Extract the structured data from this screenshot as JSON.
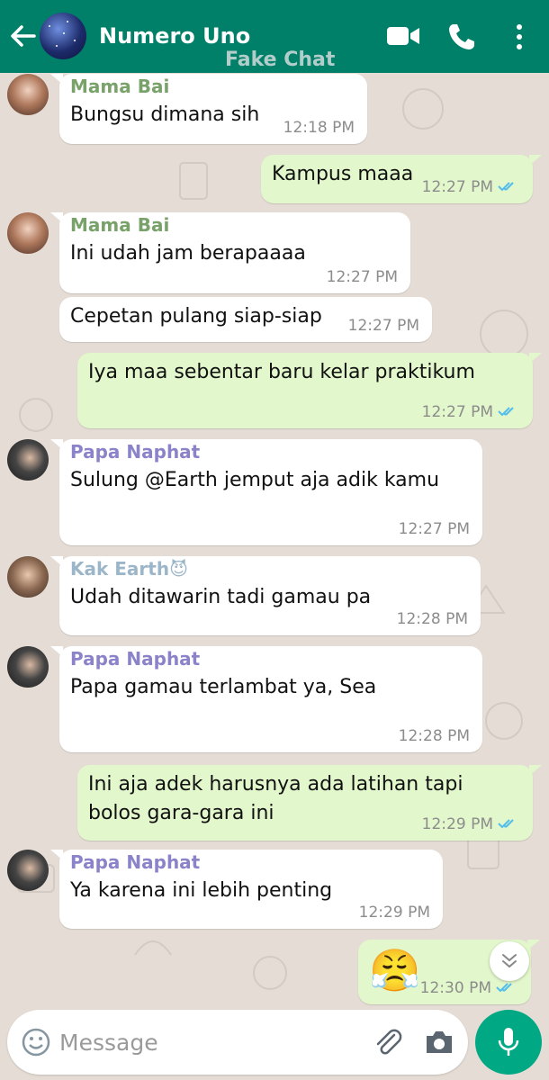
{
  "header": {
    "title": "Numero Uno",
    "watermark": "Fake Chat",
    "icons": [
      "back-arrow-icon",
      "video-call-icon",
      "phone-call-icon",
      "more-options-icon"
    ],
    "color": "#008069"
  },
  "messages": [
    {
      "direction": "in",
      "sender": "Mama Bai",
      "sender_color": "#78a26a",
      "lines": [
        "Bungsu dimana sih"
      ],
      "time": "12:18 PM"
    },
    {
      "direction": "out",
      "lines": [
        "Kampus maaa"
      ],
      "time": "12:27 PM",
      "read": true
    },
    {
      "direction": "in",
      "sender": "Mama Bai",
      "sender_color": "#78a26a",
      "lines": [
        "Ini udah jam berapaaaa"
      ],
      "time": "12:27 PM"
    },
    {
      "direction": "in",
      "lines": [
        "Cepetan pulang siap-siap"
      ],
      "time": "12:27 PM"
    },
    {
      "direction": "out",
      "lines": [
        "Iya maa sebentar baru kelar praktikum"
      ],
      "time": "12:27 PM",
      "read": true
    },
    {
      "direction": "in",
      "sender": "Papa Naphat",
      "sender_color": "#8b83c9",
      "lines": [
        "Sulung @Earth jemput aja adik kamu"
      ],
      "time": "12:27 PM"
    },
    {
      "direction": "in",
      "sender": "Kak Earth",
      "sender_emoji": "😈",
      "sender_color": "#9cb6c9",
      "lines": [
        "Udah ditawarin tadi gamau pa"
      ],
      "time": "12:28 PM"
    },
    {
      "direction": "in",
      "sender": "Papa Naphat",
      "sender_color": "#8b83c9",
      "lines": [
        "Papa gamau terlambat ya, Sea"
      ],
      "time": "12:28 PM"
    },
    {
      "direction": "out",
      "lines": [
        "Ini aja adek harusnya ada latihan tapi",
        "bolos gara-gara ini"
      ],
      "time": "12:29 PM",
      "read": true
    },
    {
      "direction": "in",
      "sender": "Papa Naphat",
      "sender_color": "#8b83c9",
      "lines": [
        "Ya karena ini lebih penting"
      ],
      "time": "12:29 PM"
    },
    {
      "direction": "out",
      "emoji": "😤",
      "time": "12:30 PM",
      "read": true
    }
  ],
  "input": {
    "placeholder": "Message",
    "icons": [
      "emoji-icon",
      "attach-icon",
      "camera-icon",
      "mic-icon",
      "scroll-down-icon"
    ],
    "accent": "#00a884"
  },
  "colors": {
    "wallpaper": "#e5ddd5",
    "incoming": "#ffffff",
    "outgoing": "#e2f7cb",
    "read_ticks": "#53bdeb"
  }
}
